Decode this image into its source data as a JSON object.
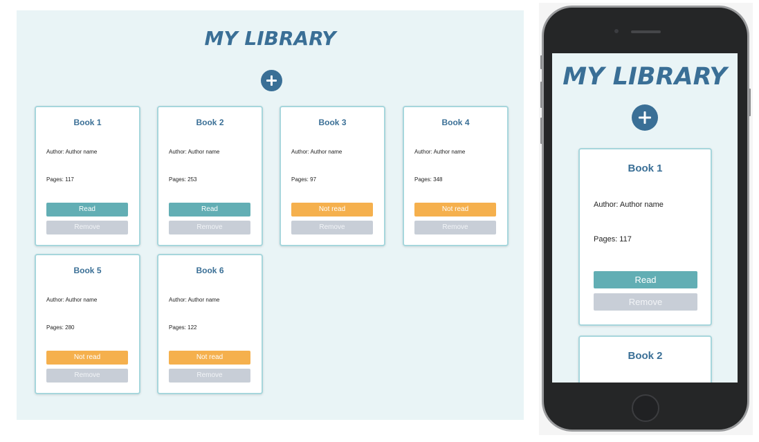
{
  "app": {
    "title": "MY LIBRARY",
    "add_icon": "plus-icon",
    "colors": {
      "background": "#e9f4f6",
      "title": "#3a6f96",
      "read": "#62aeb4",
      "not_read": "#f5b04d",
      "remove": "#c8ced7",
      "card_border": "#a6d6dc"
    }
  },
  "books": [
    {
      "title": "Book 1",
      "author": "Author: Author name",
      "pages": "Pages: 117",
      "status": "Read",
      "remove": "Remove"
    },
    {
      "title": "Book 2",
      "author": "Author: Author name",
      "pages": "Pages: 253",
      "status": "Read",
      "remove": "Remove"
    },
    {
      "title": "Book 3",
      "author": "Author: Author name",
      "pages": "Pages: 97",
      "status": "Not read",
      "remove": "Remove"
    },
    {
      "title": "Book 4",
      "author": "Author: Author name",
      "pages": "Pages: 348",
      "status": "Not read",
      "remove": "Remove"
    },
    {
      "title": "Book 5",
      "author": "Author: Author name",
      "pages": "Pages: 280",
      "status": "Not read",
      "remove": "Remove"
    },
    {
      "title": "Book 6",
      "author": "Author: Author name",
      "pages": "Pages: 122",
      "status": "Not read",
      "remove": "Remove"
    }
  ]
}
